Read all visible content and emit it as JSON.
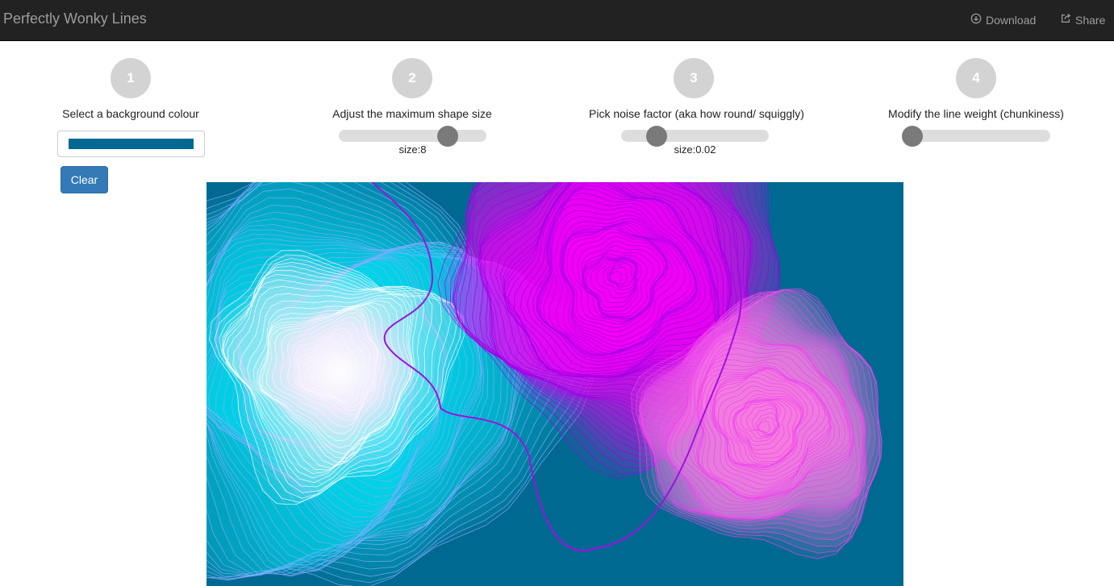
{
  "navbar": {
    "brand": "Perfectly Wonky Lines",
    "download_label": "Download",
    "share_label": "Share"
  },
  "steps": [
    {
      "number": "1",
      "label": "Select a background colour"
    },
    {
      "number": "2",
      "label": "Adjust the maximum shape size"
    },
    {
      "number": "3",
      "label": "Pick noise factor (aka how round/ squiggly)"
    },
    {
      "number": "4",
      "label": "Modify the line weight (chunkiness)"
    }
  ],
  "background": {
    "color": "#006991"
  },
  "clear_label": "Clear",
  "sliders": {
    "shape_size": {
      "value": 8,
      "fraction": 0.74,
      "readout": "size:8"
    },
    "noise": {
      "value": 0.02,
      "fraction": 0.24,
      "readout": "size:0.02"
    },
    "line_weight": {
      "fraction": 0.0
    }
  },
  "colors": {
    "navbar": "#222222",
    "nav_text": "#9d9d9d",
    "button": "#337ab7",
    "shape_cyan": "#00e6ff",
    "shape_magenta": "#ff00ff",
    "shape_pink": "#ff88ee",
    "curve": "#a010e0"
  }
}
